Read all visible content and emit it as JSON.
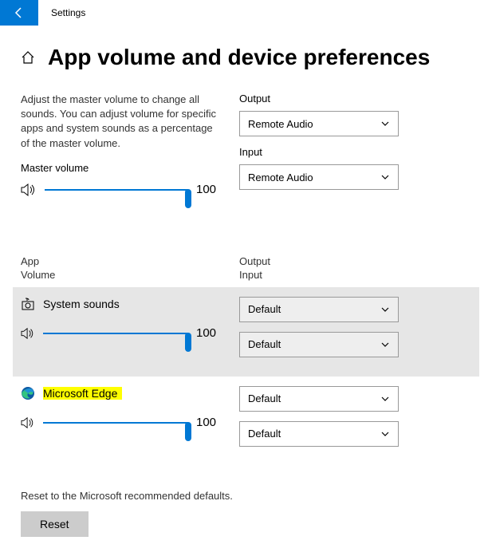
{
  "titlebar": {
    "title": "Settings"
  },
  "page": {
    "heading": "App volume and device preferences",
    "description": "Adjust the master volume to change all sounds. You can adjust volume for specific apps and system sounds as a percentage of the master volume.",
    "master_volume_label": "Master volume",
    "master_volume_value": "100",
    "output_label": "Output",
    "output_value": "Remote Audio",
    "input_label": "Input",
    "input_value": "Remote Audio"
  },
  "list_headers": {
    "left_line1": "App",
    "left_line2": "Volume",
    "right_line1": "Output",
    "right_line2": "Input"
  },
  "apps": [
    {
      "name": "System sounds",
      "volume": "100",
      "output": "Default",
      "input": "Default"
    },
    {
      "name": "Microsoft Edge",
      "volume": "100",
      "output": "Default",
      "input": "Default"
    }
  ],
  "reset": {
    "description": "Reset to the Microsoft recommended defaults.",
    "button": "Reset"
  }
}
